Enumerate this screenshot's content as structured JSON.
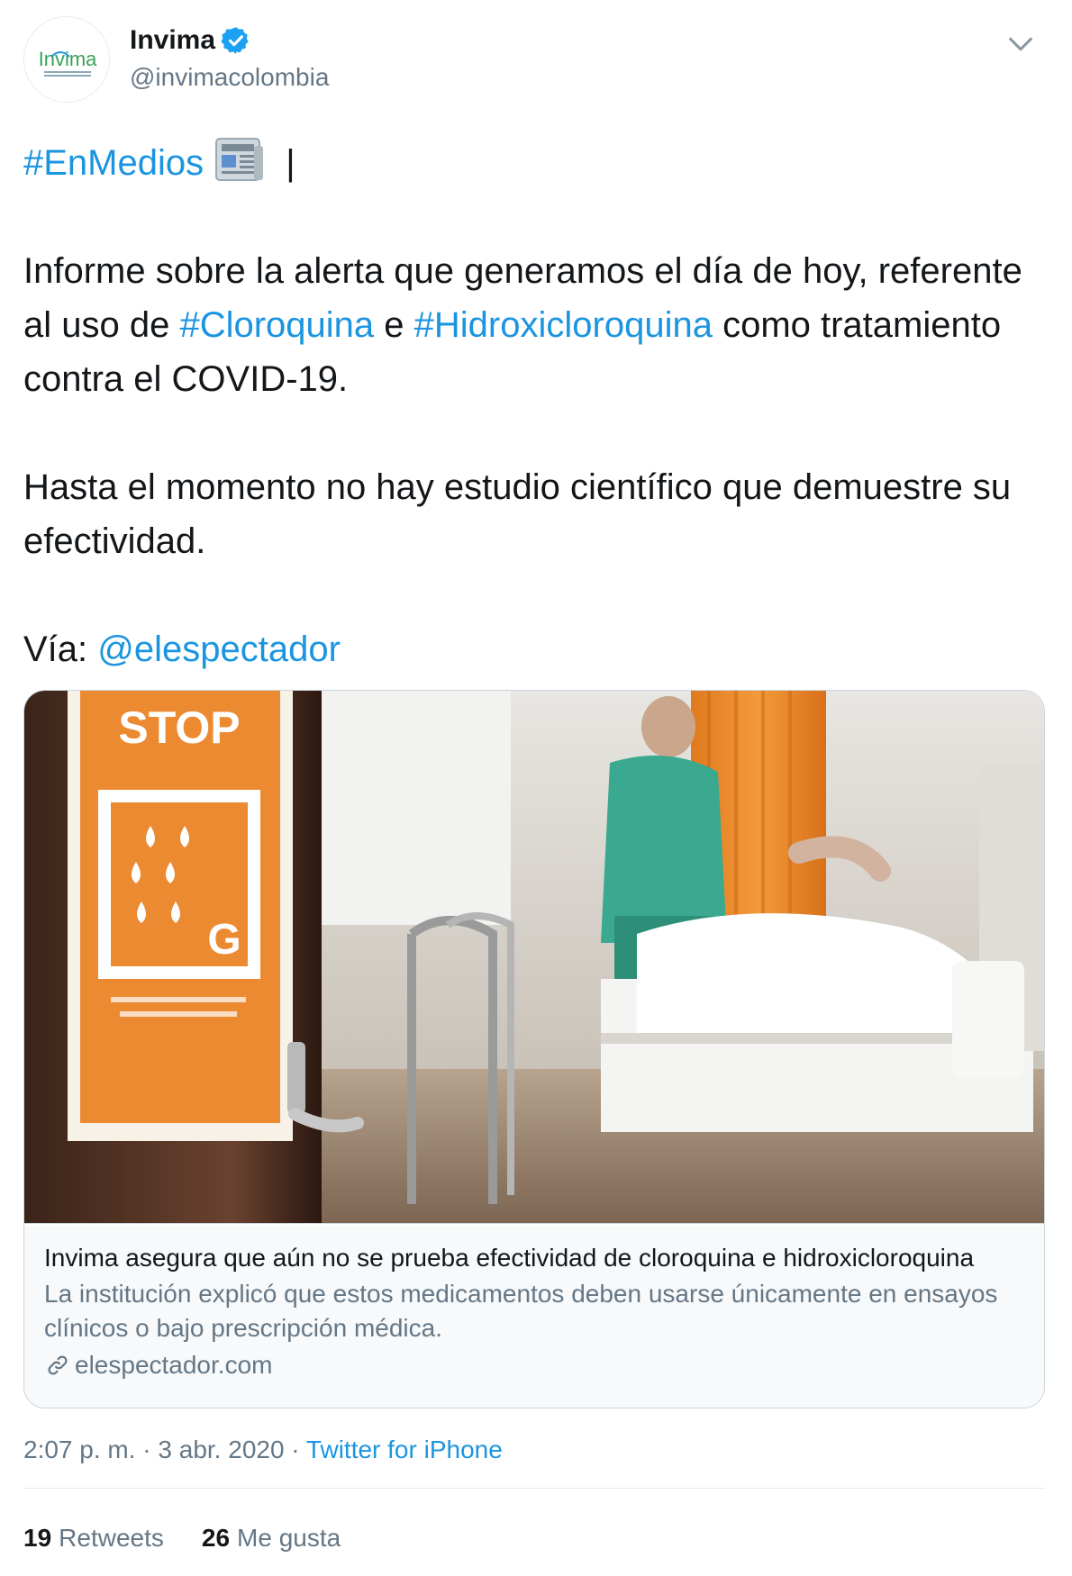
{
  "author": {
    "display_name": "Invima",
    "handle": "@invimacolombia",
    "avatar_logo_text": "Invima",
    "verified": true
  },
  "tweet": {
    "line1_hashtag": "#EnMedios",
    "line1_suffix": " |",
    "p1_before": "Informe sobre la alerta que generamos el día de hoy, referente al uso de ",
    "p1_tag1": "#Cloroquina",
    "p1_mid": " e ",
    "p1_tag2": "#Hidroxicloroquina",
    "p1_after": " como tratamiento contra el COVID-19.",
    "p2": "Hasta el momento no hay estudio científico que demuestre su efectividad.",
    "via_label": "Vía: ",
    "via_mention": "@elespectador"
  },
  "card": {
    "title": "Invima asegura que aún no se prueba efectividad de cloroquina e hidroxicloroquina",
    "description": "La institución explicó que estos medicamentos deben usarse únicamente en ensayos clínicos o bajo prescripción médica.",
    "domain": "elespectador.com",
    "sign_stop": "STOP",
    "sign_g": "G"
  },
  "meta": {
    "time": "2:07 p. m.",
    "sep": " · ",
    "date": "3 abr. 2020",
    "source": "Twitter for iPhone"
  },
  "stats": {
    "retweets_count": "19",
    "retweets_label": "Retweets",
    "likes_count": "26",
    "likes_label": "Me gusta"
  },
  "colors": {
    "link": "#1b95e0",
    "text": "#14171a",
    "secondary": "#657786",
    "verified": "#1da1f2"
  }
}
